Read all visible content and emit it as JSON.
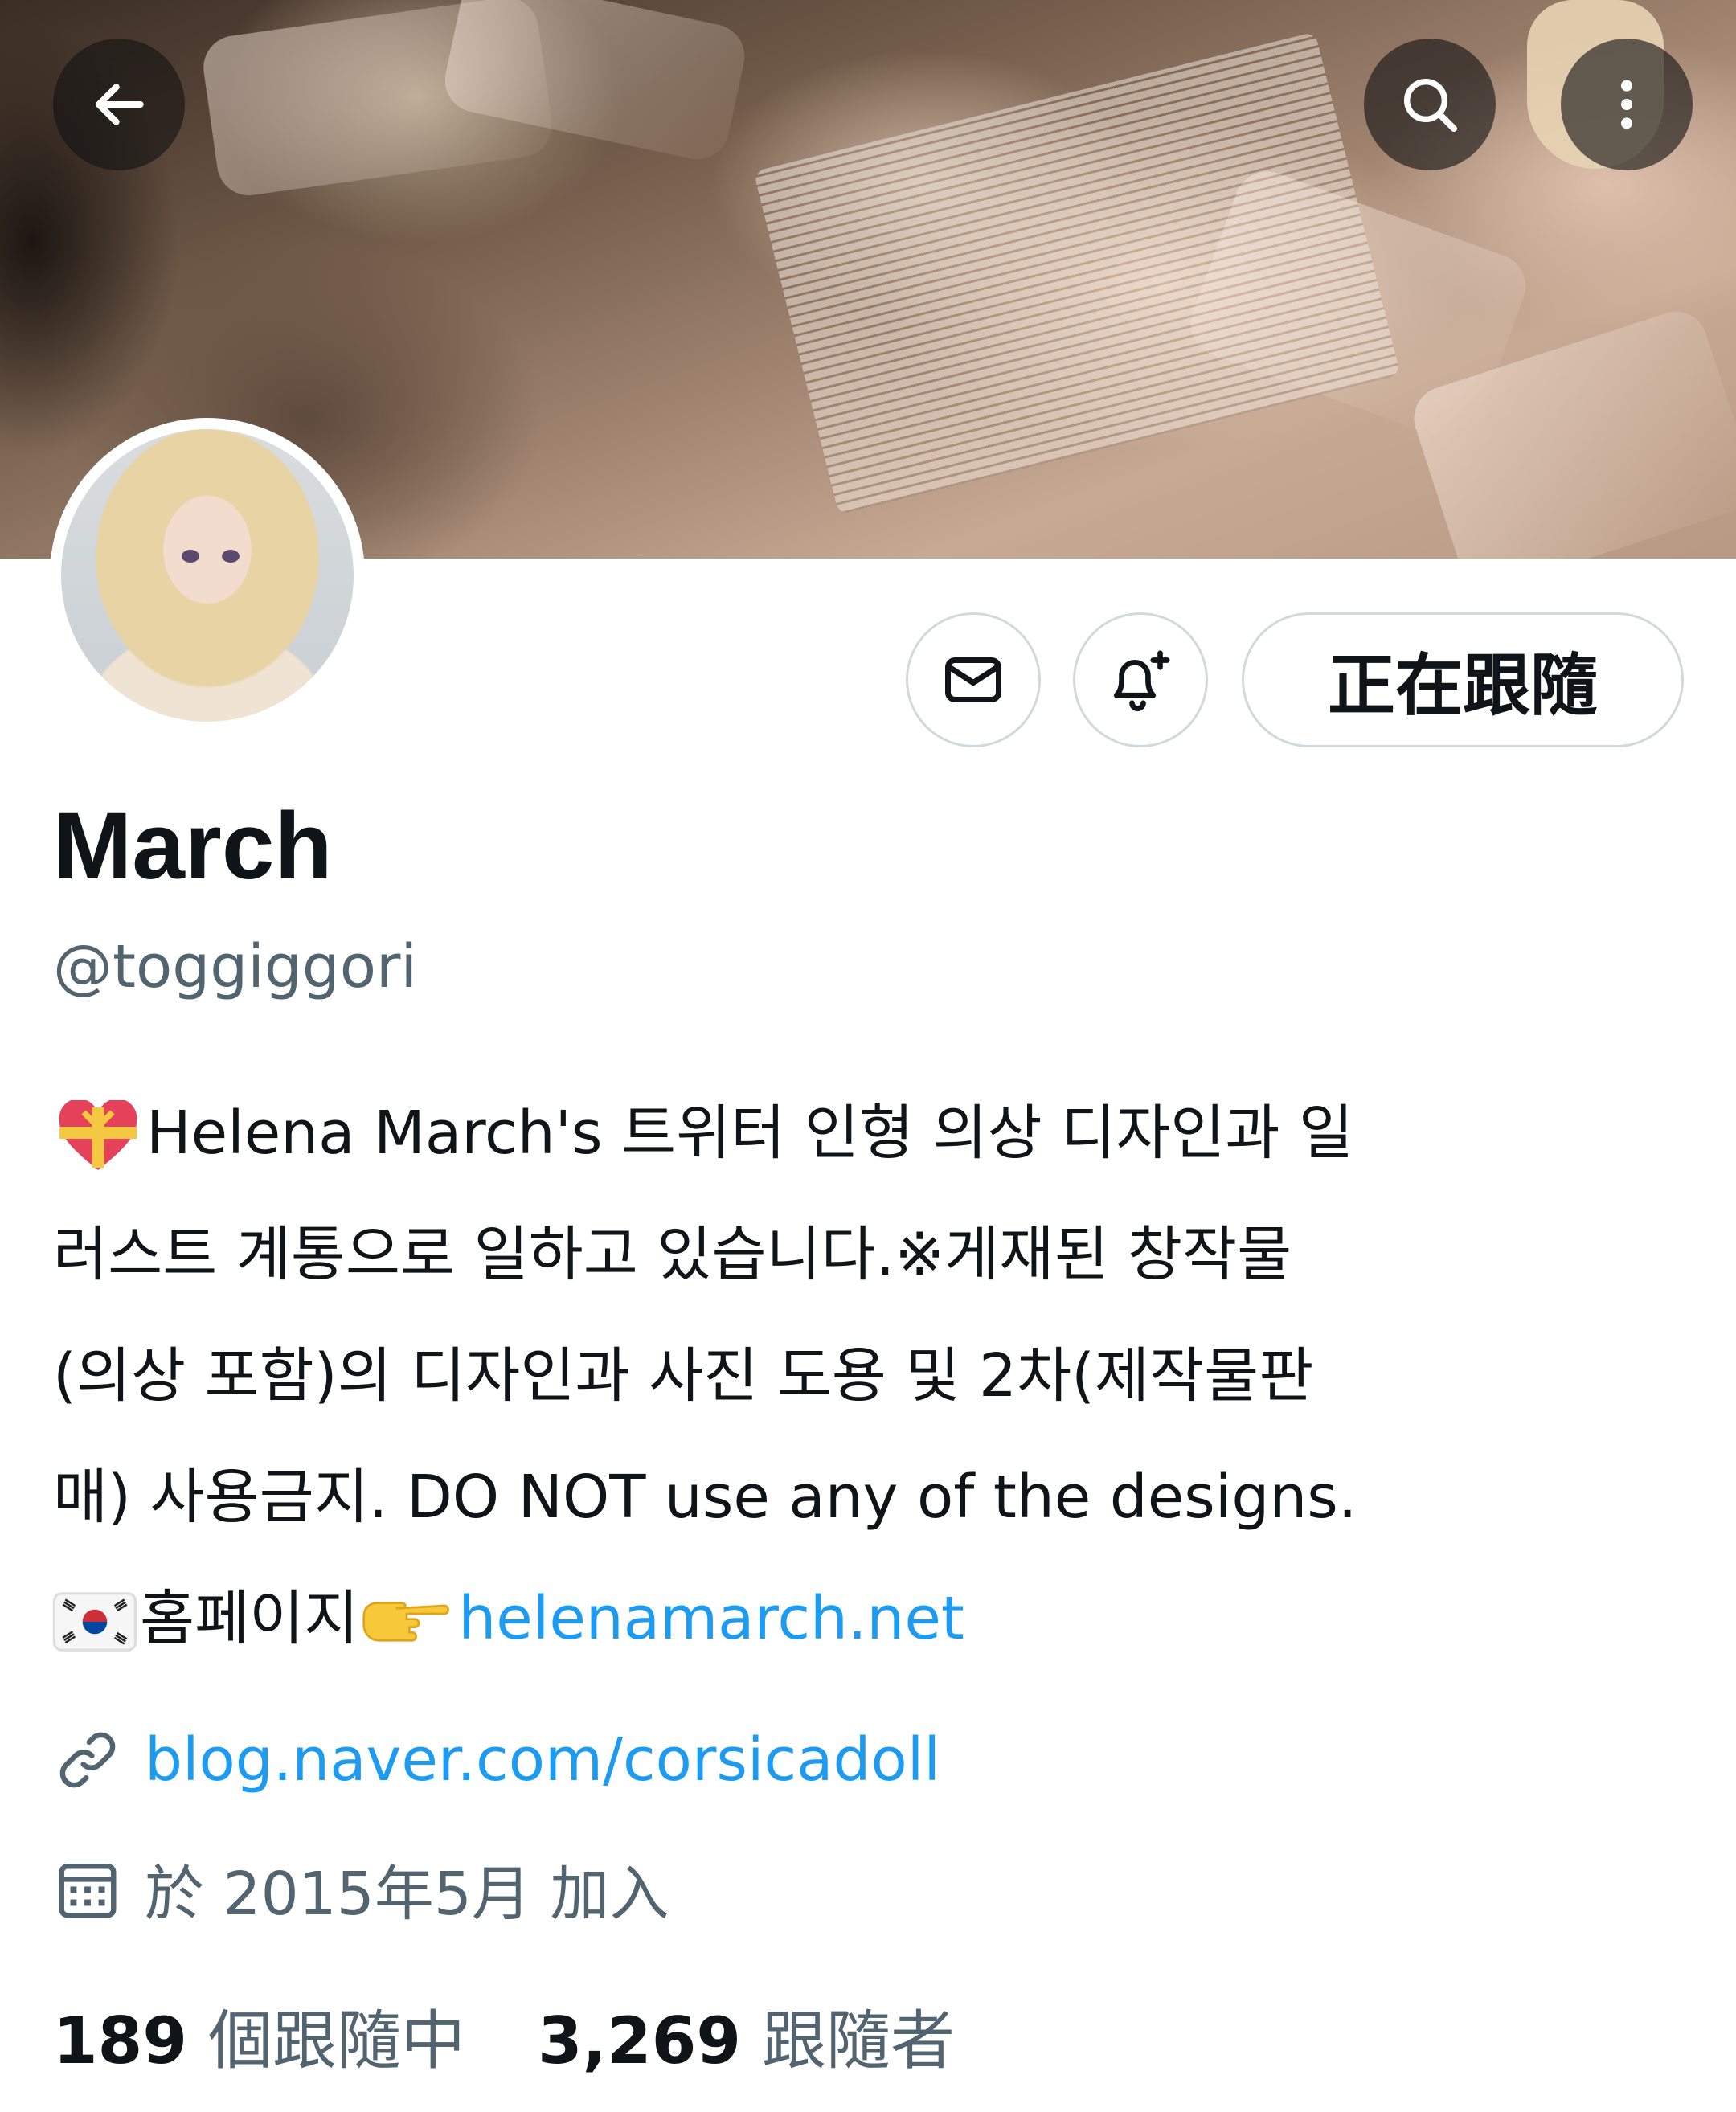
{
  "header": {
    "back_icon": "arrow-left-icon",
    "search_icon": "search-icon",
    "more_icon": "more-vertical-icon"
  },
  "profile": {
    "name": "March",
    "handle": "@toggiggori",
    "follow_button_label": "正在跟隨",
    "message_icon": "envelope-icon",
    "notify_icon": "bell-plus-icon"
  },
  "bio": {
    "line1": "Helena March's 트위터 인형 의상 디자인과 일",
    "line2": "러스트 계통으로 일하고 있습니다.※게재된 창작물",
    "line3": "(의상 포함)의 디자인과 사진 도용 및 2차(제작물판",
    "line4": "매) 사용금지. DO NOT use any of the designs.",
    "line5_text": "홈페이지",
    "line5_link": "helenamarch.net",
    "heart_emoji_icon": "heart-with-ribbon-icon",
    "flag_emoji_icon": "south-korea-flag-icon",
    "pointing_emoji_icon": "backhand-index-pointing-right-icon"
  },
  "meta": {
    "website": "blog.naver.com/corsicadoll",
    "joined": "於 2015年5月 加入",
    "link_icon": "link-icon",
    "calendar_icon": "calendar-icon"
  },
  "stats": {
    "following_count": "189",
    "following_label": "個跟隨中",
    "followers_count": "3,269",
    "followers_label": "跟隨者"
  },
  "colors": {
    "link": "#1d9bf0",
    "secondary_text": "#536471",
    "primary_text": "#0f1419",
    "button_border": "#cfd9de"
  }
}
